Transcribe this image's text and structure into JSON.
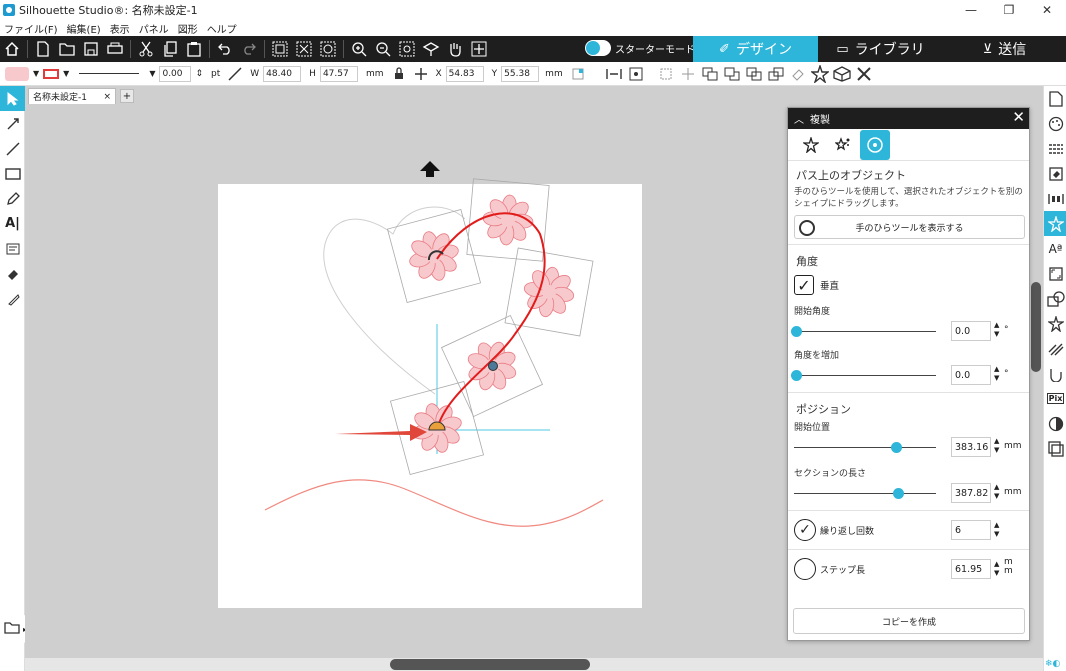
{
  "window": {
    "title": "Silhouette Studio®: 名称未設定-1",
    "controls": [
      "—",
      "❐",
      "✕"
    ]
  },
  "menu": [
    "ファイル(F)",
    "編集(E)",
    "表示",
    "パネル",
    "図形",
    "ヘルプ"
  ],
  "toolbar": {
    "starter_mode_label": "スターターモードオフ",
    "tabs": [
      {
        "label": "デザイン",
        "icon": "design-icon",
        "active": true
      },
      {
        "label": "ライブラリ",
        "icon": "folder-icon",
        "active": false
      },
      {
        "label": "送信",
        "icon": "send-icon",
        "active": false
      }
    ]
  },
  "options": {
    "fill_color": "#f8c9cc",
    "line_color": "#e23b3b",
    "line_width": "0.00",
    "line_unit": "pt",
    "w_label": "W",
    "w_value": "48.40",
    "h_label": "H",
    "h_value": "47.57",
    "size_unit": "mm",
    "x_label": "X",
    "x_value": "54.83",
    "y_label": "Y",
    "y_value": "55.38",
    "pos_unit": "mm"
  },
  "document": {
    "tab_label": "名称未設定-1",
    "close": "×",
    "add": "+"
  },
  "panel": {
    "title": "複製",
    "close": "✕",
    "section_path": "パス上のオブジェクト",
    "description": "手のひらツールを使用して、選択されたオブジェクトを別のシェイプにドラッグします。",
    "hand_tool_button": "手のひらツールを表示する",
    "angle_section": "角度",
    "vertical_label": "垂直",
    "vertical_checked": true,
    "start_angle_label": "開始角度",
    "start_angle_value": "0.0",
    "start_angle_unit": "°",
    "angle_increment_label": "角度を増加",
    "angle_increment_value": "0.0",
    "angle_increment_unit": "°",
    "position_section": "ポジション",
    "start_position_label": "開始位置",
    "start_position_value": "383.16",
    "start_position_unit": "mm",
    "section_length_label": "セクションの長さ",
    "section_length_value": "387.82",
    "section_length_unit": "mm",
    "repeat_label": "繰り返し回数",
    "repeat_value": "6",
    "repeat_selected": true,
    "step_label": "ステップ長",
    "step_value": "61.95",
    "step_unit": "m\nm",
    "make_copy_button": "コピーを作成"
  },
  "colors": {
    "accent": "#2db6d9",
    "dark_bar": "#1e1e1e",
    "flower_fill": "#f8c9cc",
    "flower_stroke": "#e87b84",
    "path_red": "#e21b1b",
    "guide_cyan": "#4cc9e6"
  }
}
